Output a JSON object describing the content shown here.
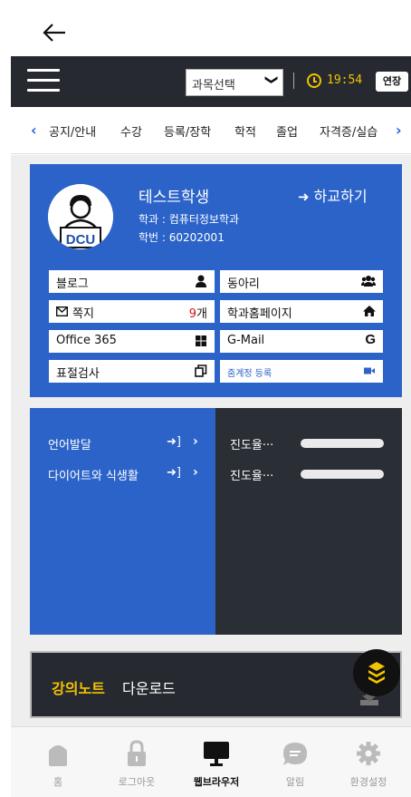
{
  "topbar": {
    "back_icon": "arrow-left-icon"
  },
  "header": {
    "menu_icon": "hamburger-icon",
    "course_select": {
      "value": "과목선택",
      "caret": "❯"
    },
    "timer_icon": "clock-icon",
    "timer": "19:54",
    "extend_label": "연장",
    "accent_color": "#f2c200"
  },
  "tabs": {
    "prev": "‹",
    "next": "›",
    "items": [
      "공지/안내",
      "수강",
      "등록/장학",
      "학적",
      "졸업",
      "자격증/실습"
    ]
  },
  "profile": {
    "name": "테스트학생",
    "logout_label": "하교하기",
    "department": "학과 : 컴퓨터정보학과",
    "student_id": "학번 : 60202001",
    "avatar_badge": "DCU",
    "card_color": "#2c63c9",
    "buttons": [
      {
        "label": "블로그",
        "icon": "user-icon"
      },
      {
        "label": "동아리",
        "icon": "users-icon"
      },
      {
        "label": "쪽지",
        "count": "9",
        "count_unit": "개",
        "icon": "envelope-icon"
      },
      {
        "label": "학과홈페이지",
        "icon": "home-icon"
      },
      {
        "label": "Office 365",
        "icon": "windows-icon"
      },
      {
        "label": "G-Mail",
        "icon": "google-icon"
      },
      {
        "label": "표절검사",
        "icon": "copy-icon"
      },
      {
        "label": "줌계정 등록",
        "icon": "video-icon"
      }
    ]
  },
  "courses": [
    {
      "name": "언어발달",
      "enter": "➜]",
      "chevron": "›",
      "progress_label": "진도율···",
      "progress": 0
    },
    {
      "name": "다이어트와 식생활",
      "enter": "➜]",
      "chevron": "›",
      "progress_label": "진도율···",
      "progress": 0
    }
  ],
  "notes": {
    "highlight": "강의노트",
    "rest": "다운로드",
    "fab_icon": "download-icon"
  },
  "bottomnav": [
    {
      "label": "홈",
      "icon": "home-icon",
      "active": false
    },
    {
      "label": "로그아웃",
      "icon": "lock-icon",
      "active": false
    },
    {
      "label": "웹브라우저",
      "icon": "monitor-icon",
      "active": true
    },
    {
      "label": "알림",
      "icon": "chat-icon",
      "active": false
    },
    {
      "label": "환경설정",
      "icon": "gear-icon",
      "active": false
    }
  ]
}
